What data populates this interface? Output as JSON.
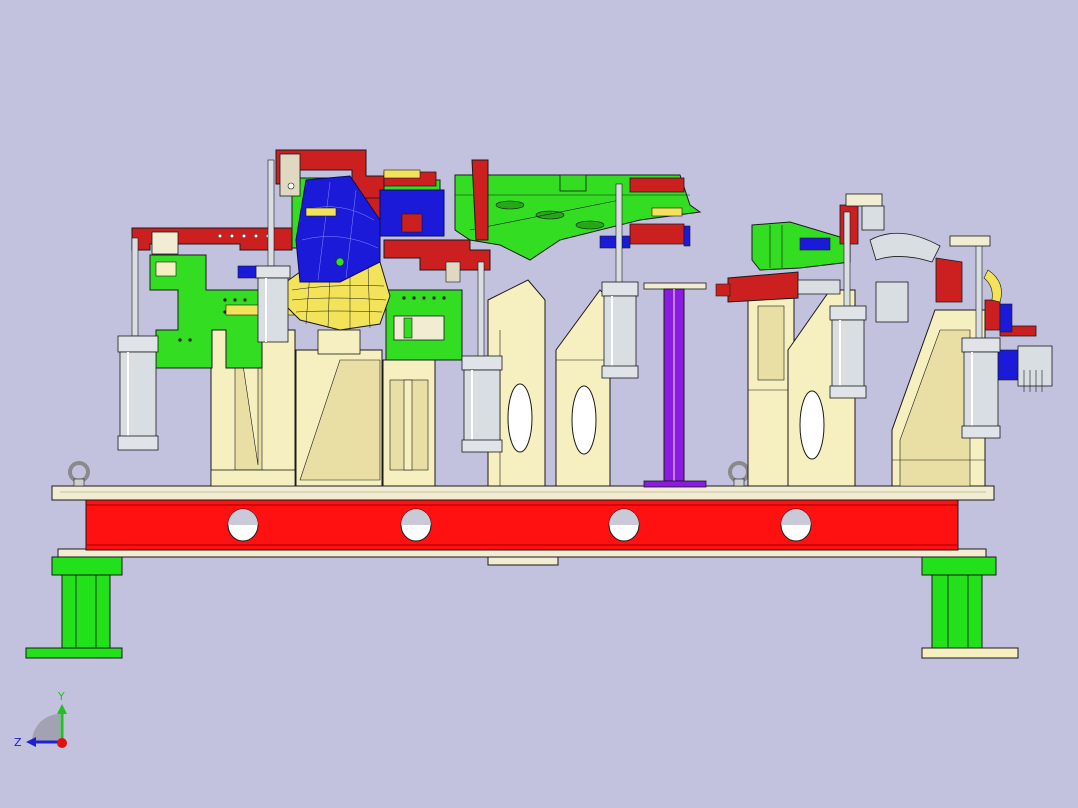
{
  "viewport": {
    "background": "#c2c2de"
  },
  "colors": {
    "fixture_cream": "#f6efc0",
    "fixture_cream_shade": "#e9dfa4",
    "clamp_arm_red": "#cc2020",
    "clamp_arm_red_dark": "#a61818",
    "locator_blue": "#1a1ad8",
    "bracket_green": "#33dd22",
    "bracket_green_dark": "#25a818",
    "part_yellow": "#f2e35a",
    "cylinder_gray": "#d8dee2",
    "base_red": "#ff1111",
    "base_plate": "#f1ecd2",
    "leg_green": "#22e01a",
    "support_purple": "#8a1ce0",
    "outline": "#1a1a1a"
  },
  "triad": {
    "y_label": "Y",
    "z_label": "Z",
    "y_color": "#22c022",
    "z_color": "#2020d0",
    "x_color": "#e01010"
  },
  "icons": {
    "axis_triad": "axis-triad-icon",
    "lifting_eye": "lifting-eye-icon"
  }
}
